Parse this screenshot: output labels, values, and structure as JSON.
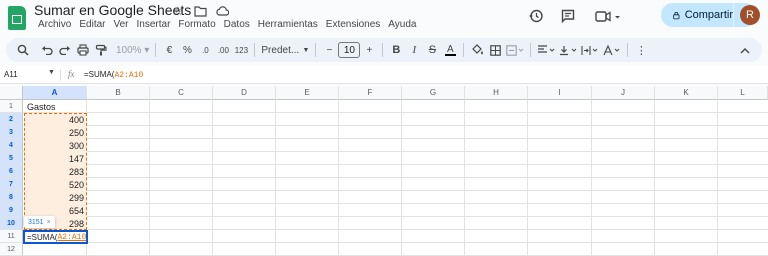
{
  "window": {
    "doc_title": "Sumar en Google Sheets"
  },
  "menu": [
    "Archivo",
    "Editar",
    "Ver",
    "Insertar",
    "Formato",
    "Datos",
    "Herramientas",
    "Extensiones",
    "Ayuda"
  ],
  "header": {
    "share_label": "Compartir",
    "avatar_letter": "R"
  },
  "toolbar": {
    "zoom": "100%",
    "currency": "€",
    "percent": "%",
    "dec_decrease": ".0",
    "dec_increase": ".00",
    "number_format": "123",
    "font_name": "Predet...",
    "font_size": "10",
    "bold": "B",
    "italic": "I",
    "text_color": "A"
  },
  "formula_bar": {
    "name_box": "A11",
    "fx": "fx",
    "formula_prefix": "=SUMA(",
    "formula_ref": "A2:A10"
  },
  "columns": [
    "A",
    "B",
    "C",
    "D",
    "E",
    "F",
    "G",
    "H",
    "I",
    "J",
    "K",
    "L"
  ],
  "rows": [
    "1",
    "2",
    "3",
    "4",
    "5",
    "6",
    "7",
    "8",
    "9",
    "10",
    "11",
    "12"
  ],
  "cells": {
    "header": "Gastos",
    "values": [
      "400",
      "250",
      "300",
      "147",
      "283",
      "520",
      "299",
      "654",
      "298"
    ]
  },
  "active_cell": {
    "prefix": "=SUMA(",
    "ref": "A2:A10"
  },
  "tooltip": {
    "sum": "3151",
    "close": "×"
  },
  "colors": {
    "accent": "#0b57d0",
    "range_highlight": "#e8710a",
    "share_bg": "#c2e7ff",
    "sheets_green": "#23a566"
  }
}
